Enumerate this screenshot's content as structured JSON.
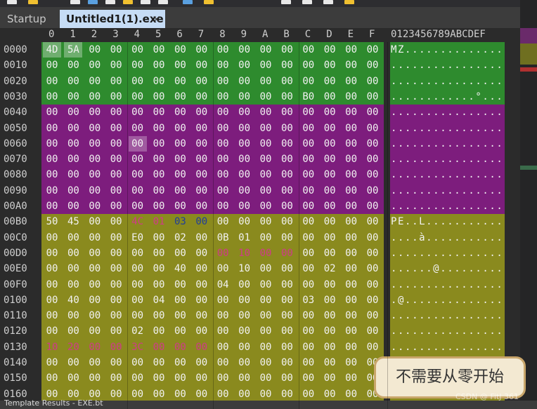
{
  "toolbar": {
    "icons": [
      "new-file-icon",
      "open-file-icon",
      "save-icon",
      "save-all-icon",
      "print-icon",
      "cut-icon",
      "copy-icon",
      "paste-icon",
      "find-icon",
      "replace-icon",
      "goto-icon",
      "bookmark-icon",
      "compare-icon",
      "calculator-icon"
    ]
  },
  "tabs": [
    {
      "label": "Startup",
      "active": false
    },
    {
      "label": "Untitled1(1).exe",
      "active": true,
      "close": "×"
    }
  ],
  "header": {
    "columns": [
      "0",
      "1",
      "2",
      "3",
      "4",
      "5",
      "6",
      "7",
      "8",
      "9",
      "A",
      "B",
      "C",
      "D",
      "E",
      "F"
    ],
    "ascii_header": "0123456789ABCDEF"
  },
  "rows": [
    {
      "offset": "0000",
      "band": "g",
      "bytes": [
        "4D",
        "5A",
        "00",
        "00",
        "00",
        "00",
        "00",
        "00",
        "00",
        "00",
        "00",
        "00",
        "00",
        "00",
        "00",
        "00"
      ],
      "ascii": "MZ.............."
    },
    {
      "offset": "0010",
      "band": "g",
      "bytes": [
        "00",
        "00",
        "00",
        "00",
        "00",
        "00",
        "00",
        "00",
        "00",
        "00",
        "00",
        "00",
        "00",
        "00",
        "00",
        "00"
      ],
      "ascii": "................"
    },
    {
      "offset": "0020",
      "band": "g",
      "bytes": [
        "00",
        "00",
        "00",
        "00",
        "00",
        "00",
        "00",
        "00",
        "00",
        "00",
        "00",
        "00",
        "00",
        "00",
        "00",
        "00"
      ],
      "ascii": "................"
    },
    {
      "offset": "0030",
      "band": "g",
      "bytes": [
        "00",
        "00",
        "00",
        "00",
        "00",
        "00",
        "00",
        "00",
        "00",
        "00",
        "00",
        "00",
        "B0",
        "00",
        "00",
        "00"
      ],
      "ascii": "............°..."
    },
    {
      "offset": "0040",
      "band": "p",
      "bytes": [
        "00",
        "00",
        "00",
        "00",
        "00",
        "00",
        "00",
        "00",
        "00",
        "00",
        "00",
        "00",
        "00",
        "00",
        "00",
        "00"
      ],
      "ascii": "................"
    },
    {
      "offset": "0050",
      "band": "p",
      "bytes": [
        "00",
        "00",
        "00",
        "00",
        "00",
        "00",
        "00",
        "00",
        "00",
        "00",
        "00",
        "00",
        "00",
        "00",
        "00",
        "00"
      ],
      "ascii": "................"
    },
    {
      "offset": "0060",
      "band": "p",
      "bytes": [
        "00",
        "00",
        "00",
        "00",
        "00",
        "00",
        "00",
        "00",
        "00",
        "00",
        "00",
        "00",
        "00",
        "00",
        "00",
        "00"
      ],
      "ascii": "................"
    },
    {
      "offset": "0070",
      "band": "p",
      "bytes": [
        "00",
        "00",
        "00",
        "00",
        "00",
        "00",
        "00",
        "00",
        "00",
        "00",
        "00",
        "00",
        "00",
        "00",
        "00",
        "00"
      ],
      "ascii": "................"
    },
    {
      "offset": "0080",
      "band": "p",
      "bytes": [
        "00",
        "00",
        "00",
        "00",
        "00",
        "00",
        "00",
        "00",
        "00",
        "00",
        "00",
        "00",
        "00",
        "00",
        "00",
        "00"
      ],
      "ascii": "................"
    },
    {
      "offset": "0090",
      "band": "p",
      "bytes": [
        "00",
        "00",
        "00",
        "00",
        "00",
        "00",
        "00",
        "00",
        "00",
        "00",
        "00",
        "00",
        "00",
        "00",
        "00",
        "00"
      ],
      "ascii": "................"
    },
    {
      "offset": "00A0",
      "band": "p",
      "bytes": [
        "00",
        "00",
        "00",
        "00",
        "00",
        "00",
        "00",
        "00",
        "00",
        "00",
        "00",
        "00",
        "00",
        "00",
        "00",
        "00"
      ],
      "ascii": "................"
    },
    {
      "offset": "00B0",
      "band": "o",
      "bytes": [
        "50",
        "45",
        "00",
        "00",
        "4C",
        "01",
        "03",
        "00",
        "00",
        "00",
        "00",
        "00",
        "00",
        "00",
        "00",
        "00"
      ],
      "ascii": "PE..L..........."
    },
    {
      "offset": "00C0",
      "band": "o",
      "bytes": [
        "00",
        "00",
        "00",
        "00",
        "E0",
        "00",
        "02",
        "00",
        "0B",
        "01",
        "00",
        "00",
        "00",
        "00",
        "00",
        "00"
      ],
      "ascii": "....à..........."
    },
    {
      "offset": "00D0",
      "band": "o",
      "bytes": [
        "00",
        "00",
        "00",
        "00",
        "00",
        "00",
        "00",
        "00",
        "00",
        "10",
        "00",
        "00",
        "00",
        "00",
        "00",
        "00"
      ],
      "ascii": "................"
    },
    {
      "offset": "00E0",
      "band": "o",
      "bytes": [
        "00",
        "00",
        "00",
        "00",
        "00",
        "00",
        "40",
        "00",
        "00",
        "10",
        "00",
        "00",
        "00",
        "02",
        "00",
        "00"
      ],
      "ascii": "......@........."
    },
    {
      "offset": "00F0",
      "band": "o",
      "bytes": [
        "00",
        "00",
        "00",
        "00",
        "00",
        "00",
        "00",
        "00",
        "04",
        "00",
        "00",
        "00",
        "00",
        "00",
        "00",
        "00"
      ],
      "ascii": "................"
    },
    {
      "offset": "0100",
      "band": "o",
      "bytes": [
        "00",
        "40",
        "00",
        "00",
        "00",
        "04",
        "00",
        "00",
        "00",
        "00",
        "00",
        "00",
        "03",
        "00",
        "00",
        "00"
      ],
      "ascii": ".@.............."
    },
    {
      "offset": "0110",
      "band": "o",
      "bytes": [
        "00",
        "00",
        "00",
        "00",
        "00",
        "00",
        "00",
        "00",
        "00",
        "00",
        "00",
        "00",
        "00",
        "00",
        "00",
        "00"
      ],
      "ascii": "................"
    },
    {
      "offset": "0120",
      "band": "o",
      "bytes": [
        "00",
        "00",
        "00",
        "00",
        "02",
        "00",
        "00",
        "00",
        "00",
        "00",
        "00",
        "00",
        "00",
        "00",
        "00",
        "00"
      ],
      "ascii": "................"
    },
    {
      "offset": "0130",
      "band": "o",
      "bytes": [
        "10",
        "20",
        "00",
        "00",
        "3C",
        "00",
        "00",
        "00",
        "00",
        "00",
        "00",
        "00",
        "00",
        "00",
        "00",
        "00"
      ],
      "ascii": "................"
    },
    {
      "offset": "0140",
      "band": "o",
      "bytes": [
        "00",
        "00",
        "00",
        "00",
        "00",
        "00",
        "00",
        "00",
        "00",
        "00",
        "00",
        "00",
        "00",
        "00",
        "00",
        "00"
      ],
      "ascii": "................"
    },
    {
      "offset": "0150",
      "band": "o",
      "bytes": [
        "00",
        "00",
        "00",
        "00",
        "00",
        "00",
        "00",
        "00",
        "00",
        "00",
        "00",
        "00",
        "00",
        "00",
        "00",
        "00"
      ],
      "ascii": "................"
    },
    {
      "offset": "0160",
      "band": "o",
      "bytes": [
        "00",
        "00",
        "00",
        "00",
        "00",
        "00",
        "00",
        "00",
        "00",
        "00",
        "00",
        "00",
        "00",
        "00",
        "00",
        "00"
      ],
      "ascii": "................"
    }
  ],
  "highlights": {
    "selected": [
      [
        0,
        0
      ],
      [
        0,
        1
      ]
    ],
    "purple_cursor": [
      [
        6,
        4
      ]
    ],
    "pink": [
      [
        11,
        4
      ],
      [
        11,
        5
      ],
      [
        13,
        8
      ],
      [
        13,
        9
      ],
      [
        13,
        10
      ],
      [
        13,
        11
      ],
      [
        19,
        0
      ],
      [
        19,
        1
      ],
      [
        19,
        2
      ],
      [
        19,
        3
      ],
      [
        19,
        4
      ],
      [
        19,
        5
      ],
      [
        19,
        6
      ],
      [
        19,
        7
      ]
    ],
    "navy": [
      [
        11,
        6
      ],
      [
        11,
        7
      ]
    ]
  },
  "statusbar": {
    "text": "Template Results - EXE.bt"
  },
  "overlay": {
    "caption": "不需要从零开始"
  },
  "watermark": "CSDN @ FitJ 361",
  "colors": {
    "header_band": "#2e8b2e",
    "dos_stub_band": "#7d1d7d",
    "nt_headers_band": "#8a8a1e",
    "active_tab": "#c6dcf5",
    "pink_text": "#d03a8a",
    "navy_text": "#1f3d9a"
  }
}
